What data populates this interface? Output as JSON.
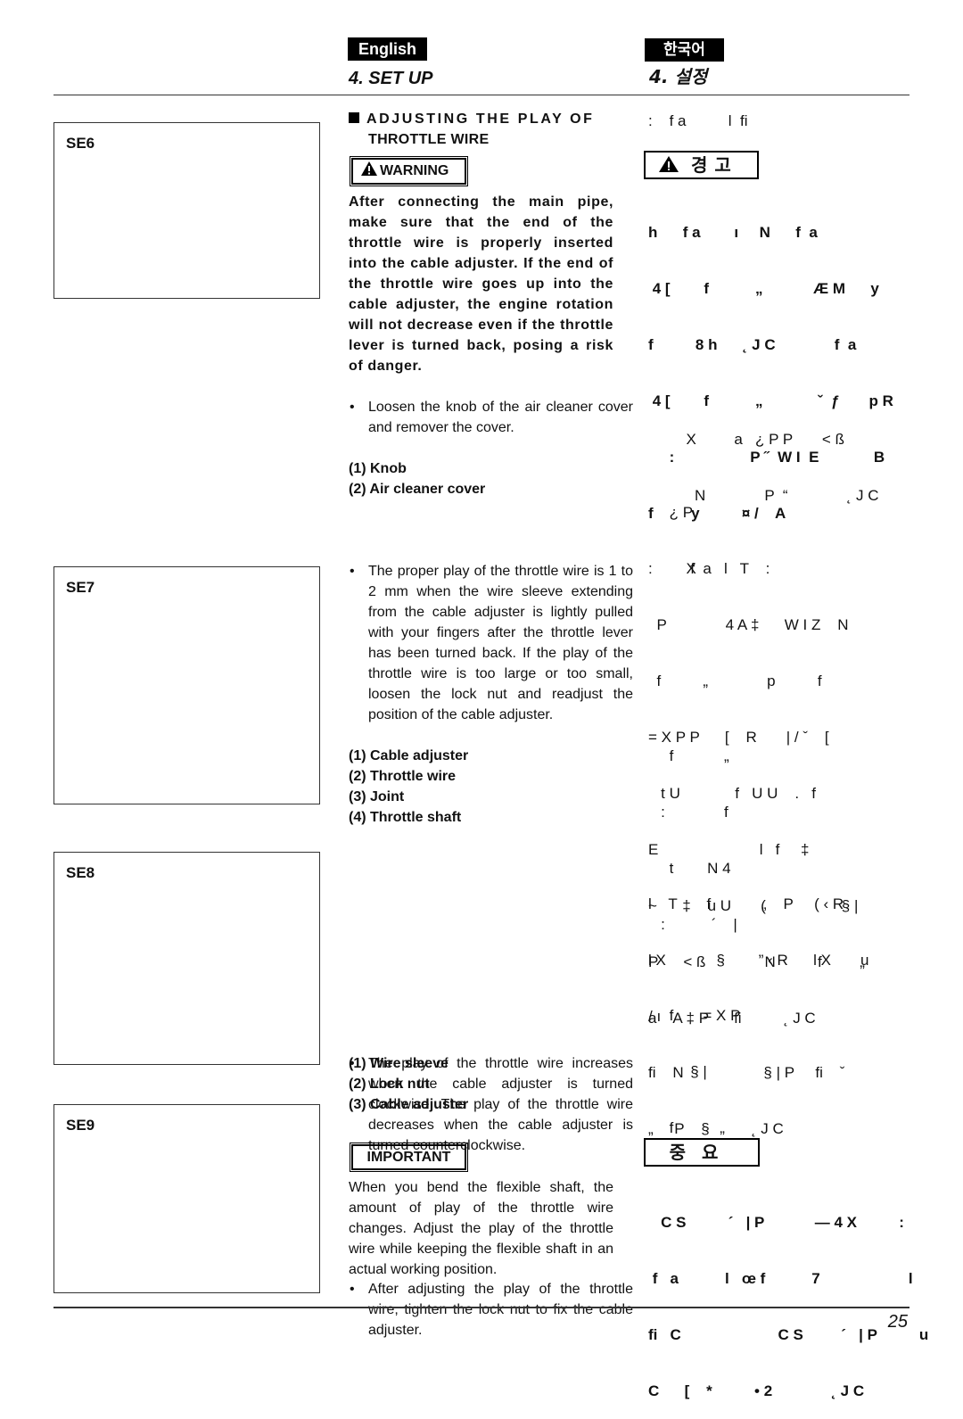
{
  "header": {
    "lang_en": "English",
    "lang_ko": "한국어",
    "section_title_en": "4. SET UP",
    "section_title_ko": "4. 설정"
  },
  "figures": [
    {
      "label": "SE6"
    },
    {
      "label": "SE7"
    },
    {
      "label": "SE8"
    },
    {
      "label": "SE9"
    }
  ],
  "english": {
    "heading_line1": "ADJUSTING THE PLAY OF",
    "heading_line2": "THROTTLE WIRE",
    "warning_label": "WARNING",
    "warning_text": "After connecting the main pipe, make sure that the end of the throttle wire is properly inserted into the cable adjuster. If the end of the throttle wire goes up into the cable adjuster, the engine rotation will not decrease even if the throttle lever is turned back, posing a risk of danger.",
    "step1": "Loosen the knob of the air cleaner cover and remover the cover.",
    "parts1": [
      "(1) Knob",
      "(2) Air cleaner cover"
    ],
    "step2": "The proper play of the throttle wire is 1 to 2 mm when the wire sleeve extending from the cable adjuster is lightly pulled with your fingers after the throttle lever has been turned back. If the play of the throttle wire is too large or too small, loosen the lock nut and readjust the position of the cable adjuster.",
    "parts2": [
      "(1) Cable adjuster",
      "(2) Throttle wire",
      "(3) Joint",
      "(4) Throttle shaft"
    ],
    "step3": "The play of the throttle wire increases when the cable adjuster is turned clockwise. The play of the throttle wire decreases when the cable adjuster is turned counterclockwise.",
    "step4": "After adjusting the play of the throttle wire, tighten the lock nut to fix the cable adjuster.",
    "parts3": [
      "(1) Wire sleeve",
      "(2) Lock nut",
      "(3) Cable adjuster"
    ],
    "important_label": "IMPORTANT",
    "important_text": "When you bend the flexible shaft, the amount of play of the throttle wire changes. Adjust the play of the throttle wire while keeping the flexible shaft in an actual working position."
  },
  "korean": {
    "heading": ":    f a          l  fi",
    "warning_label": "경고",
    "warning_lines": [
      "h      f a        ı     N      f  a",
      " 4 [        f           „            Æ M      y",
      "f          8 h      ˛ J C              f  a",
      " 4 [        f           „             ˇ  ƒ       p R",
      "     :                  P ˝  W I  E             B",
      "f         y          ¤ /    A"
    ],
    "step1_lines": [
      "         X         a   ¿ P P       < ß",
      "           N              P  “              ˛ J C"
    ],
    "parts1_lines": [
      "     ¿ P",
      "         X"
    ],
    "step2_lines": [
      ":         f  a   l   T    :",
      "  P              4 A ‡      W I Z    N",
      "  f          „              p          f",
      "= X P P      [    R       | / ˇ    [",
      "   t U             f   U U    .   f",
      "E                        l   f     ‡",
      "~      ‡    u U       (                  § |",
      "P      < ß              N          f         „",
      "a    A ‡ P      fi          ˛ J C"
    ],
    "parts2_lines": [
      "     f            „",
      "   :              f",
      "     t        N 4",
      "   :           ´    |"
    ],
    "step3_lines": [
      "l    T       f            „    P     ( ‹ R",
      "l X            §        ” ‹ R      l X       u",
      "/ ı",
      "fi    N                   § | P     fi    ˇ",
      "„     P    §          ˛ J C"
    ],
    "parts3_lines": [
      "     f       = X P",
      "          § |",
      "     f           „"
    ],
    "important_label": "중요",
    "important_lines": [
      "   C S          ´   | P            — 4 X          :",
      " f   a           l   œ f           7                     l",
      "fi   C                       C S         ´   | P          u",
      "C      [    *          • 2              ˛ J C"
    ]
  },
  "footer": {
    "page_number": "25"
  }
}
